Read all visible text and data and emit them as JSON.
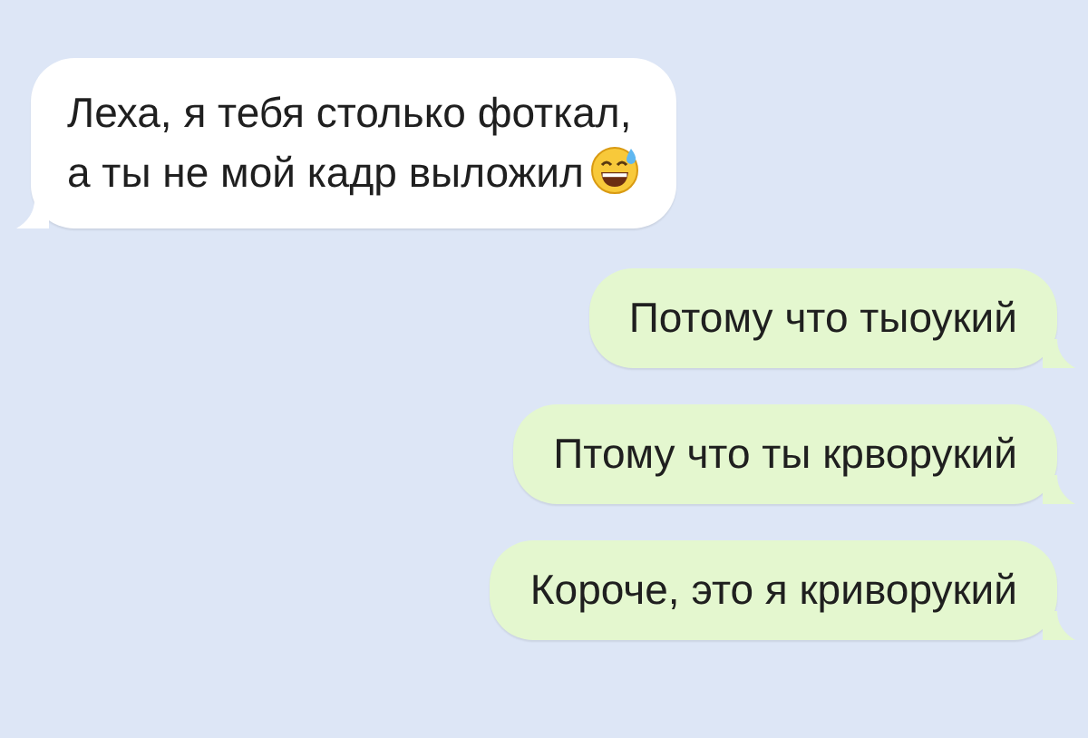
{
  "messages": [
    {
      "kind": "incoming",
      "text": "Леха, я тебя столько фоткал,\nа ты не мой кадр выложил",
      "has_emoji": true
    },
    {
      "kind": "outgoing",
      "text": "Потому что тыоукий",
      "has_emoji": false
    },
    {
      "kind": "outgoing",
      "text": "Птому что ты крворукий",
      "has_emoji": false
    },
    {
      "kind": "outgoing",
      "text": "Короче, это я криворукий",
      "has_emoji": false
    }
  ]
}
